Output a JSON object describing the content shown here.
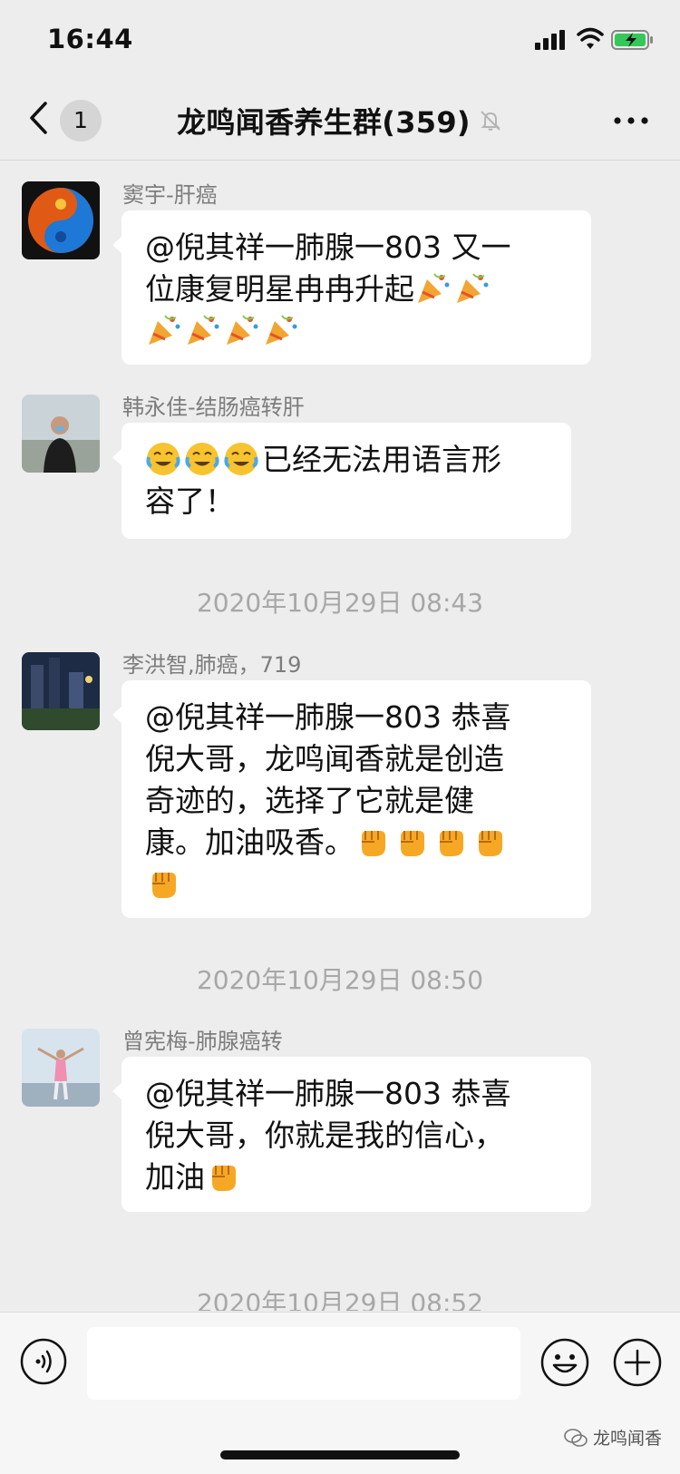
{
  "status_bar": {
    "time": "16:44"
  },
  "nav": {
    "back_count": "1",
    "title": "龙鸣闻香养生群(359)"
  },
  "messages": [
    {
      "sender": "窦宇-肝癌",
      "text_line1": "@倪其祥一肺腺一803 又一",
      "text_line2": "位康复明星冉冉升起",
      "emoji_name": "party-popper-icon"
    },
    {
      "sender": "韩永佳-结肠癌转肝",
      "text_line1_after_emoji": "已经无法用语言形",
      "text_line2": "容了！",
      "emoji_name": "crying-laugh-icon"
    },
    {
      "sender": "李洪智,肺癌，719",
      "text_line1": "@倪其祥一肺腺一803 恭喜",
      "text_line2": "倪大哥，龙鸣闻香就是创造",
      "text_line3": "奇迹的，选择了它就是健",
      "text_line4": "康。加油吸香。",
      "emoji_name": "fist-icon"
    },
    {
      "sender": "曾宪梅-肺腺癌转",
      "text_line1": "@倪其祥一肺腺一803 恭喜",
      "text_line2": "倪大哥，你就是我的信心，",
      "text_line3": "加油",
      "emoji_name": "fist-icon"
    }
  ],
  "timestamps": [
    "2020年10月29日 08:43",
    "2020年10月29日 08:50",
    "2020年10月29日 08:52"
  ],
  "input": {
    "placeholder": ""
  },
  "watermark": {
    "text": "龙鸣闻香"
  },
  "colors": {
    "background": "#ededed",
    "bubble": "#ffffff",
    "meta_text": "#a7a7a7"
  }
}
